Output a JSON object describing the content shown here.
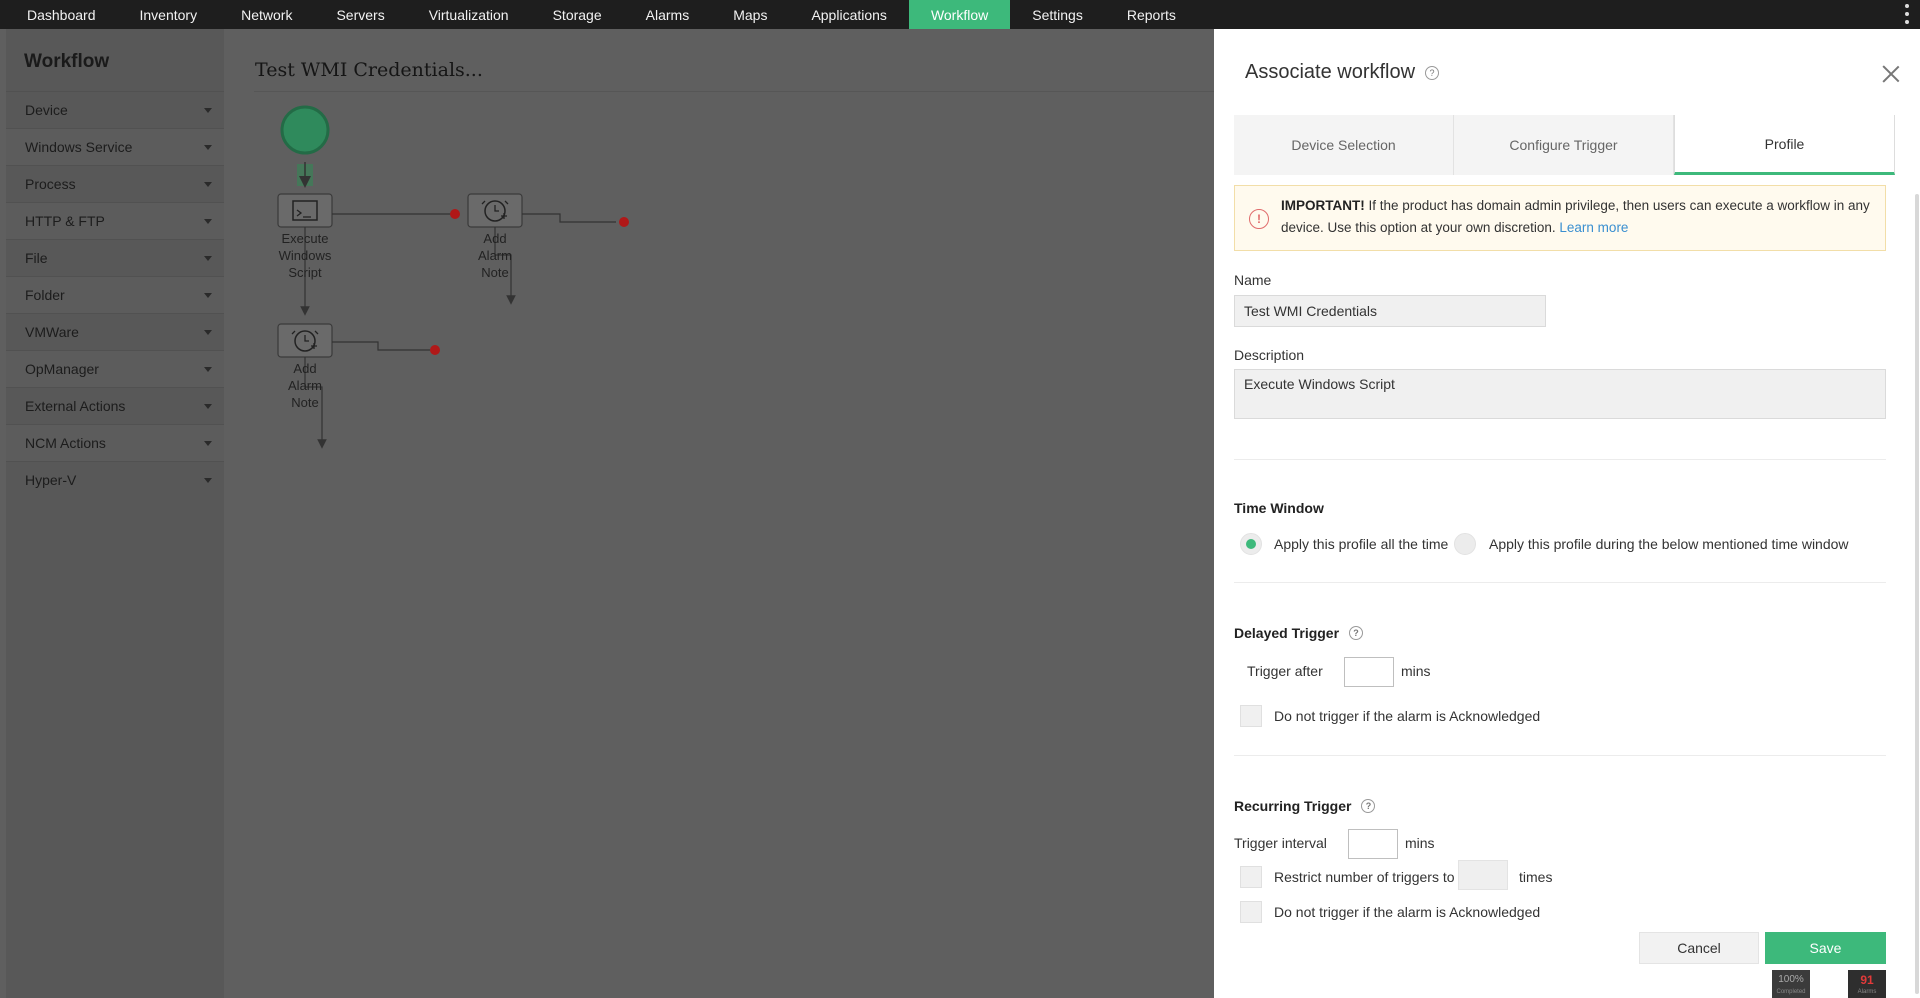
{
  "nav": {
    "items": [
      "Dashboard",
      "Inventory",
      "Network",
      "Servers",
      "Virtualization",
      "Storage",
      "Alarms",
      "Maps",
      "Applications",
      "Workflow",
      "Settings",
      "Reports"
    ],
    "active": "Workflow"
  },
  "sidebar": {
    "title": "Workflow",
    "items": [
      "Device",
      "Windows Service",
      "Process",
      "HTTP & FTP",
      "File",
      "Folder",
      "VMWare",
      "OpManager",
      "External Actions",
      "NCM Actions",
      "Hyper-V"
    ]
  },
  "canvas": {
    "title": "Test WMI Credentials...",
    "nodes": [
      {
        "label": "Execute Windows Script",
        "icon": "terminal-icon"
      },
      {
        "label": "Add Alarm Note",
        "icon": "alarm-add-icon"
      },
      {
        "label": "Add Alarm Note",
        "icon": "alarm-add-icon"
      }
    ]
  },
  "panel": {
    "title": "Associate workflow",
    "help": "?",
    "tabs": [
      "Device Selection",
      "Configure Trigger",
      "Profile"
    ],
    "active_tab": "Profile",
    "notice": {
      "bold": "IMPORTANT!",
      "text": " If the product has domain admin privilege, then users can execute a workflow in any device. Use this option at your own discretion. ",
      "link": "Learn more"
    },
    "name_label": "Name",
    "name_value": "Test WMI Credentials",
    "description_label": "Description",
    "description_value": "Execute Windows Script",
    "time_window": {
      "heading": "Time Window",
      "option_all": "Apply this profile all the time",
      "option_window": "Apply this profile during the below mentioned time window",
      "selected": "all"
    },
    "delayed": {
      "heading": "Delayed Trigger",
      "trigger_after": "Trigger after",
      "mins": "mins",
      "ack": "Do not trigger if the alarm is Acknowledged"
    },
    "recurring": {
      "heading": "Recurring Trigger",
      "interval": "Trigger interval",
      "mins": "mins",
      "restrict": "Restrict number of triggers to",
      "times": "times",
      "ack": "Do not trigger if the alarm is Acknowledged"
    },
    "cancel": "Cancel",
    "save": "Save"
  },
  "status": {
    "progress": "100%",
    "progress_caption": "Completed",
    "alarms": "91",
    "alarms_caption": "Alarms"
  },
  "colors": {
    "accent": "#3db97b",
    "error": "#e06c6c",
    "link": "#3a8fd0"
  }
}
